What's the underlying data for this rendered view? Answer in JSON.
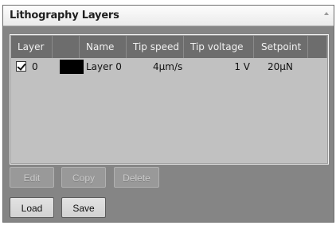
{
  "panel": {
    "title": "Lithography Layers"
  },
  "grid": {
    "columns": [
      "Layer",
      "",
      "Name",
      "Tip speed",
      "Tip voltage",
      "Setpoint"
    ],
    "rows": [
      {
        "checked": true,
        "layer": "0",
        "color": "#000000",
        "name": "Layer 0",
        "tip_speed": "4µm/s",
        "tip_voltage": "1 V",
        "setpoint": "20µN"
      }
    ]
  },
  "buttons": {
    "edit": "Edit",
    "copy": "Copy",
    "delete": "Delete",
    "load": "Load",
    "save": "Save"
  }
}
